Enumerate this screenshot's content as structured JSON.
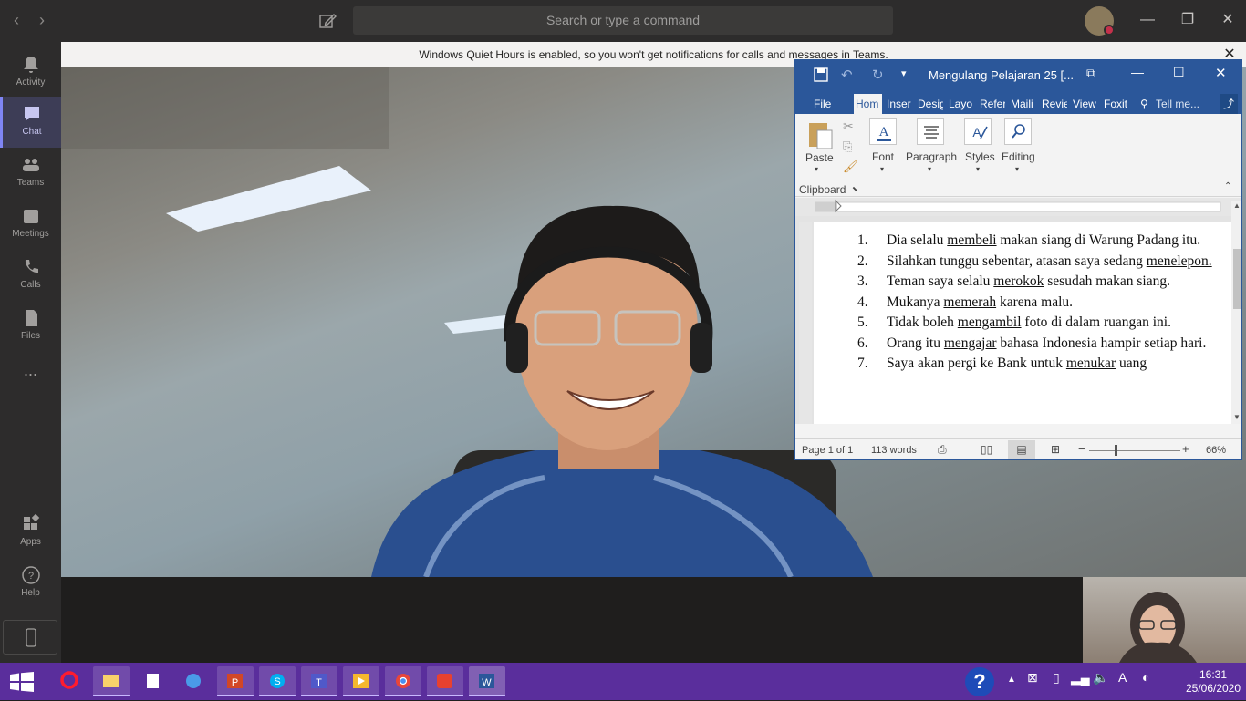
{
  "teams": {
    "search_placeholder": "Search or type a command",
    "notice": "Windows Quiet Hours is enabled, so you won't get notifications for calls and messages in Teams.",
    "rail": [
      {
        "label": "Activity",
        "icon": "bell-icon"
      },
      {
        "label": "Chat",
        "icon": "chat-icon",
        "active": true
      },
      {
        "label": "Teams",
        "icon": "teams-icon"
      },
      {
        "label": "Meetings",
        "icon": "calendar-icon"
      },
      {
        "label": "Calls",
        "icon": "phone-icon"
      },
      {
        "label": "Files",
        "icon": "file-icon"
      },
      {
        "label": "...",
        "icon": "more-icon"
      },
      {
        "label": "Apps",
        "icon": "apps-icon"
      },
      {
        "label": "Help",
        "icon": "help-icon"
      }
    ],
    "accent": "#7f85f5"
  },
  "word": {
    "title": "Mengulang Pelajaran 25 [...",
    "tabs": [
      "File",
      "Hom",
      "Inser",
      "Desig",
      "Layo",
      "Refer",
      "Maili",
      "Revie",
      "View",
      "Foxit",
      "Tell me..."
    ],
    "ribbon": {
      "clipboard_label": "Clipboard",
      "paste_label": "Paste",
      "font_label": "Font",
      "paragraph_label": "Paragraph",
      "styles_label": "Styles",
      "editing_label": "Editing"
    },
    "document": [
      {
        "num": "1.",
        "pre": "Dia selalu ",
        "u": "membeli",
        "post": " makan siang di Warung Padang itu."
      },
      {
        "num": "2.",
        "pre": "Silahkan tunggu sebentar, atasan saya sedang ",
        "u": "menelepon.",
        "post": ""
      },
      {
        "num": "3.",
        "pre": "Teman saya selalu ",
        "u": "merokok",
        "post": " sesudah makan siang."
      },
      {
        "num": "4.",
        "pre": "Mukanya ",
        "u": "memerah",
        "post": " karena malu."
      },
      {
        "num": "5.",
        "pre": "Tidak boleh ",
        "u": "mengambil",
        "post": " foto di dalam ruangan ini."
      },
      {
        "num": "6.",
        "pre": "Orang itu ",
        "u": "mengajar",
        "post": " bahasa Indonesia hampir setiap hari."
      },
      {
        "num": "7.",
        "pre": "Saya akan pergi ke Bank untuk ",
        "u": "menukar",
        "post": " uang"
      }
    ],
    "status": {
      "page": "Page 1 of 1",
      "words": "113 words",
      "zoom": "66%"
    },
    "brand_color": "#2b579a"
  },
  "taskbar": {
    "time": "16:31",
    "date": "25/06/2020",
    "color": "#5a2e9c"
  }
}
